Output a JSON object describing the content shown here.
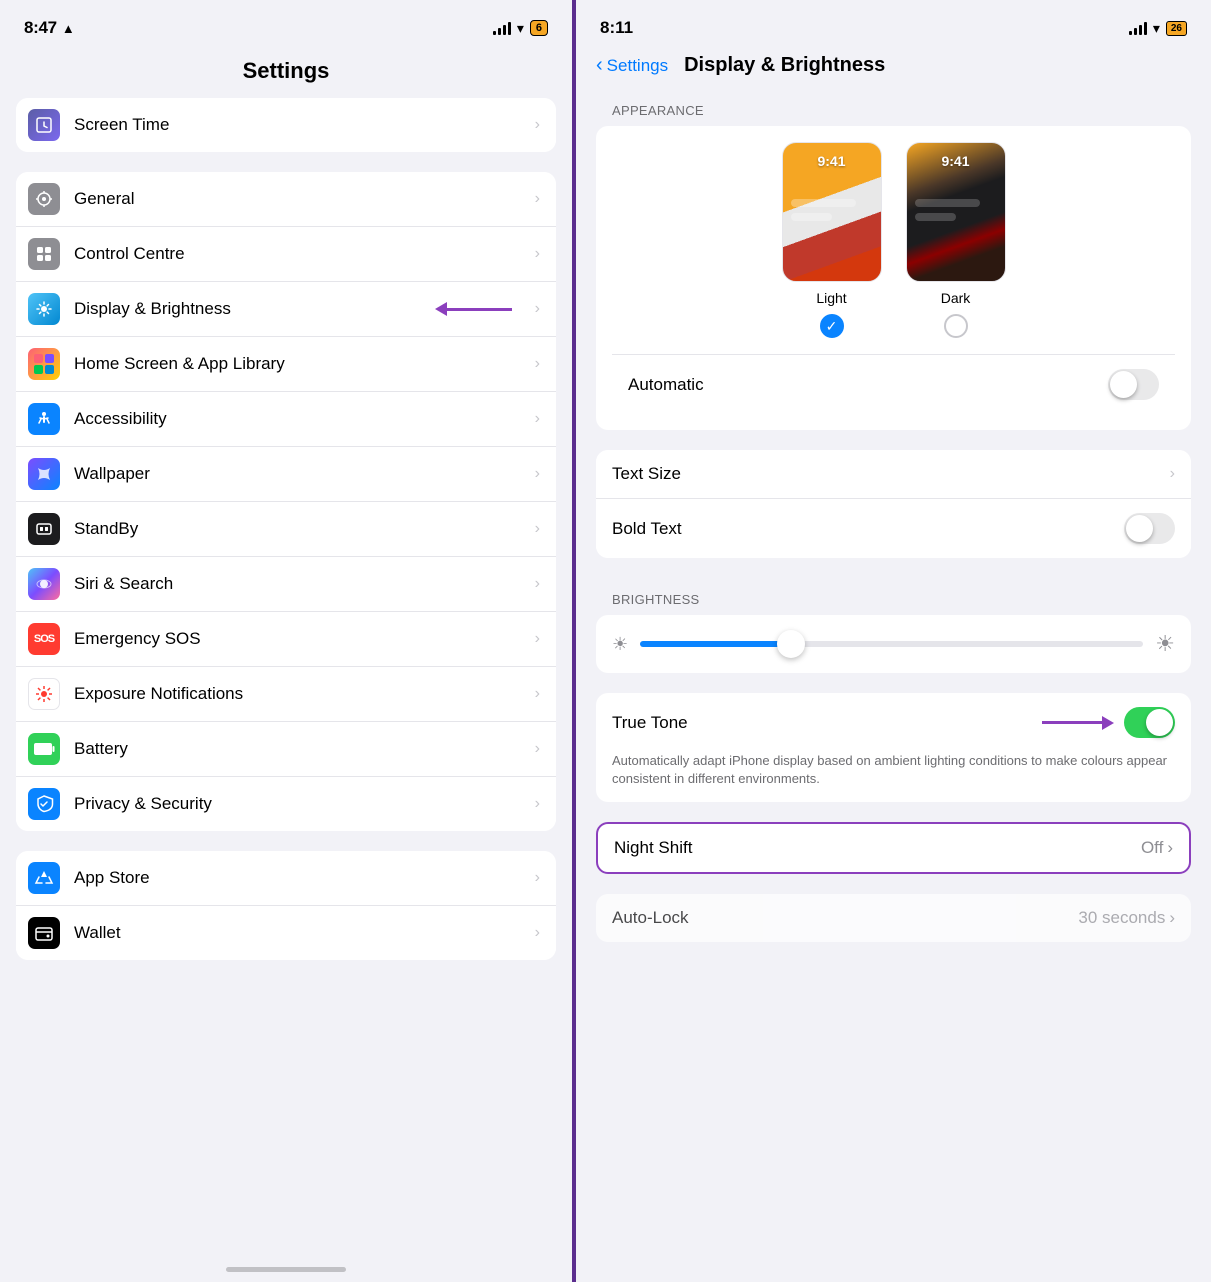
{
  "left": {
    "status": {
      "time": "8:47",
      "location_arrow": true,
      "battery_label": "6"
    },
    "title": "Settings",
    "groups": [
      {
        "items": [
          {
            "id": "screen-time",
            "label": "Screen Time",
            "icon_type": "screen-time"
          }
        ]
      },
      {
        "items": [
          {
            "id": "general",
            "label": "General",
            "icon_type": "general"
          },
          {
            "id": "control-centre",
            "label": "Control Centre",
            "icon_type": "control"
          },
          {
            "id": "display-brightness",
            "label": "Display & Brightness",
            "icon_type": "display",
            "has_arrow": true
          },
          {
            "id": "home-screen",
            "label": "Home Screen & App Library",
            "icon_type": "home"
          },
          {
            "id": "accessibility",
            "label": "Accessibility",
            "icon_type": "accessibility"
          },
          {
            "id": "wallpaper",
            "label": "Wallpaper",
            "icon_type": "wallpaper"
          },
          {
            "id": "standby",
            "label": "StandBy",
            "icon_type": "standby"
          },
          {
            "id": "siri-search",
            "label": "Siri & Search",
            "icon_type": "siri"
          },
          {
            "id": "emergency-sos",
            "label": "Emergency SOS",
            "icon_type": "emergency"
          },
          {
            "id": "exposure",
            "label": "Exposure Notifications",
            "icon_type": "exposure"
          },
          {
            "id": "battery",
            "label": "Battery",
            "icon_type": "battery"
          },
          {
            "id": "privacy",
            "label": "Privacy & Security",
            "icon_type": "privacy"
          }
        ]
      },
      {
        "items": [
          {
            "id": "app-store",
            "label": "App Store",
            "icon_type": "appstore"
          },
          {
            "id": "wallet",
            "label": "Wallet",
            "icon_type": "wallet"
          }
        ]
      }
    ]
  },
  "right": {
    "status": {
      "time": "8:11",
      "battery_label": "26"
    },
    "nav": {
      "back_label": "Settings",
      "title": "Display & Brightness"
    },
    "sections": {
      "appearance_label": "APPEARANCE",
      "brightness_label": "BRIGHTNESS"
    },
    "appearance": {
      "light_label": "Light",
      "dark_label": "Dark",
      "light_time": "9:41",
      "dark_time": "9:41",
      "automatic_label": "Automatic",
      "automatic_on": false
    },
    "text": {
      "text_size_label": "Text Size",
      "bold_text_label": "Bold Text",
      "bold_text_on": false
    },
    "brightness": {
      "slider_percent": 30,
      "true_tone_label": "True Tone",
      "true_tone_on": true,
      "true_tone_desc": "Automatically adapt iPhone display based on ambient lighting conditions to make colours appear consistent in different environments."
    },
    "night_shift": {
      "label": "Night Shift",
      "value": "Off"
    },
    "auto_lock": {
      "label": "Auto-Lock",
      "value": "30 seconds"
    }
  }
}
